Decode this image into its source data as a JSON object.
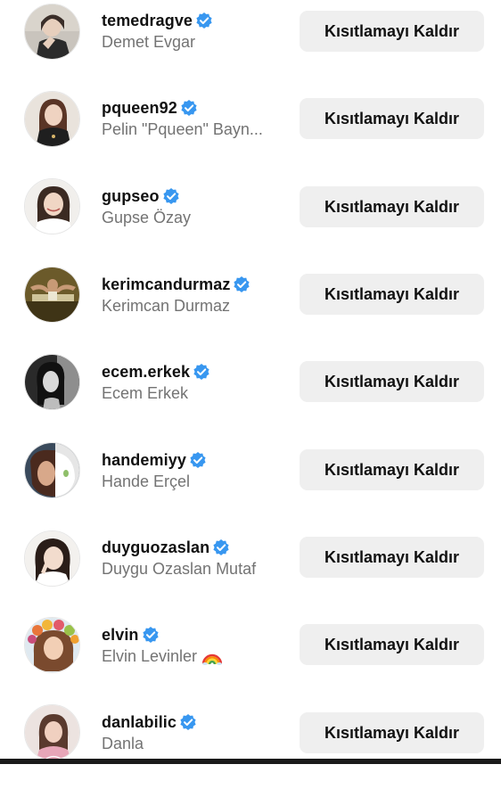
{
  "accounts": [
    {
      "username": "temedragve",
      "full_name": "Demet Evgar",
      "verified": true,
      "action": "Kısıtlamayı Kaldır"
    },
    {
      "username": "pqueen92",
      "full_name": "Pelin \"Pqueen\" Bayn...",
      "verified": true,
      "action": "Kısıtlamayı Kaldır"
    },
    {
      "username": "gupseo",
      "full_name": "Gupse Özay",
      "verified": true,
      "action": "Kısıtlamayı Kaldır"
    },
    {
      "username": "kerimcandurmaz",
      "full_name": "Kerimcan Durmaz",
      "verified": true,
      "action": "Kısıtlamayı Kaldır"
    },
    {
      "username": "ecem.erkek",
      "full_name": "Ecem Erkek",
      "verified": true,
      "action": "Kısıtlamayı Kaldır"
    },
    {
      "username": "handemiyy",
      "full_name": "Hande Erçel",
      "verified": true,
      "action": "Kısıtlamayı Kaldır"
    },
    {
      "username": "duyguozaslan",
      "full_name": "Duygu Ozaslan Mutaf",
      "verified": true,
      "action": "Kısıtlamayı Kaldır"
    },
    {
      "username": "elvin",
      "full_name": "Elvin Levinler",
      "verified": true,
      "action": "Kısıtlamayı Kaldır",
      "name_emoji": "rainbow-emoji"
    },
    {
      "username": "danlabilic",
      "full_name": "Danla",
      "verified": true,
      "action": "Kısıtlamayı Kaldır"
    }
  ],
  "colors": {
    "verified_badge": "#3897f0",
    "button_bg": "#efefef",
    "secondary_text": "#737373",
    "primary_text": "#111111"
  },
  "icons": {
    "verified": "verified-badge-icon",
    "avatar": "profile-photo"
  }
}
